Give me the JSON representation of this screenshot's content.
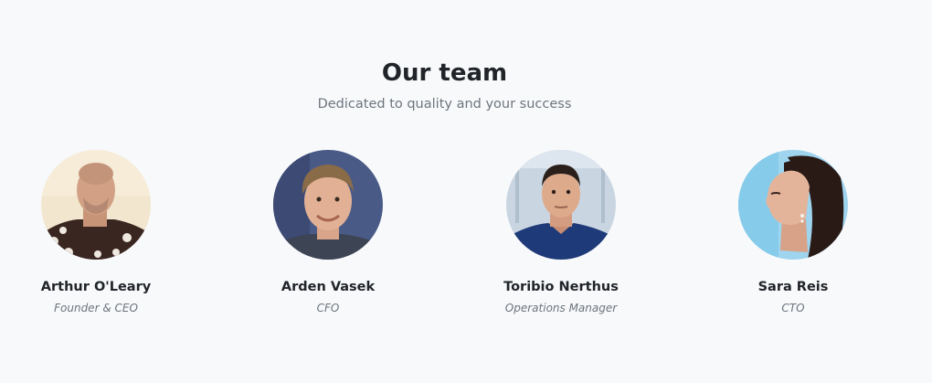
{
  "team": {
    "title": "Our team",
    "subtitle": "Dedicated to quality and your success",
    "members": [
      {
        "name": "Arthur O'Leary",
        "role": "Founder & CEO",
        "avatar": "photo-arthur"
      },
      {
        "name": "Arden Vasek",
        "role": "CFO",
        "avatar": "photo-arden"
      },
      {
        "name": "Toribio Nerthus",
        "role": "Operations Manager",
        "avatar": "photo-toribio"
      },
      {
        "name": "Sara Reis",
        "role": "CTO",
        "avatar": "photo-sara"
      }
    ]
  }
}
